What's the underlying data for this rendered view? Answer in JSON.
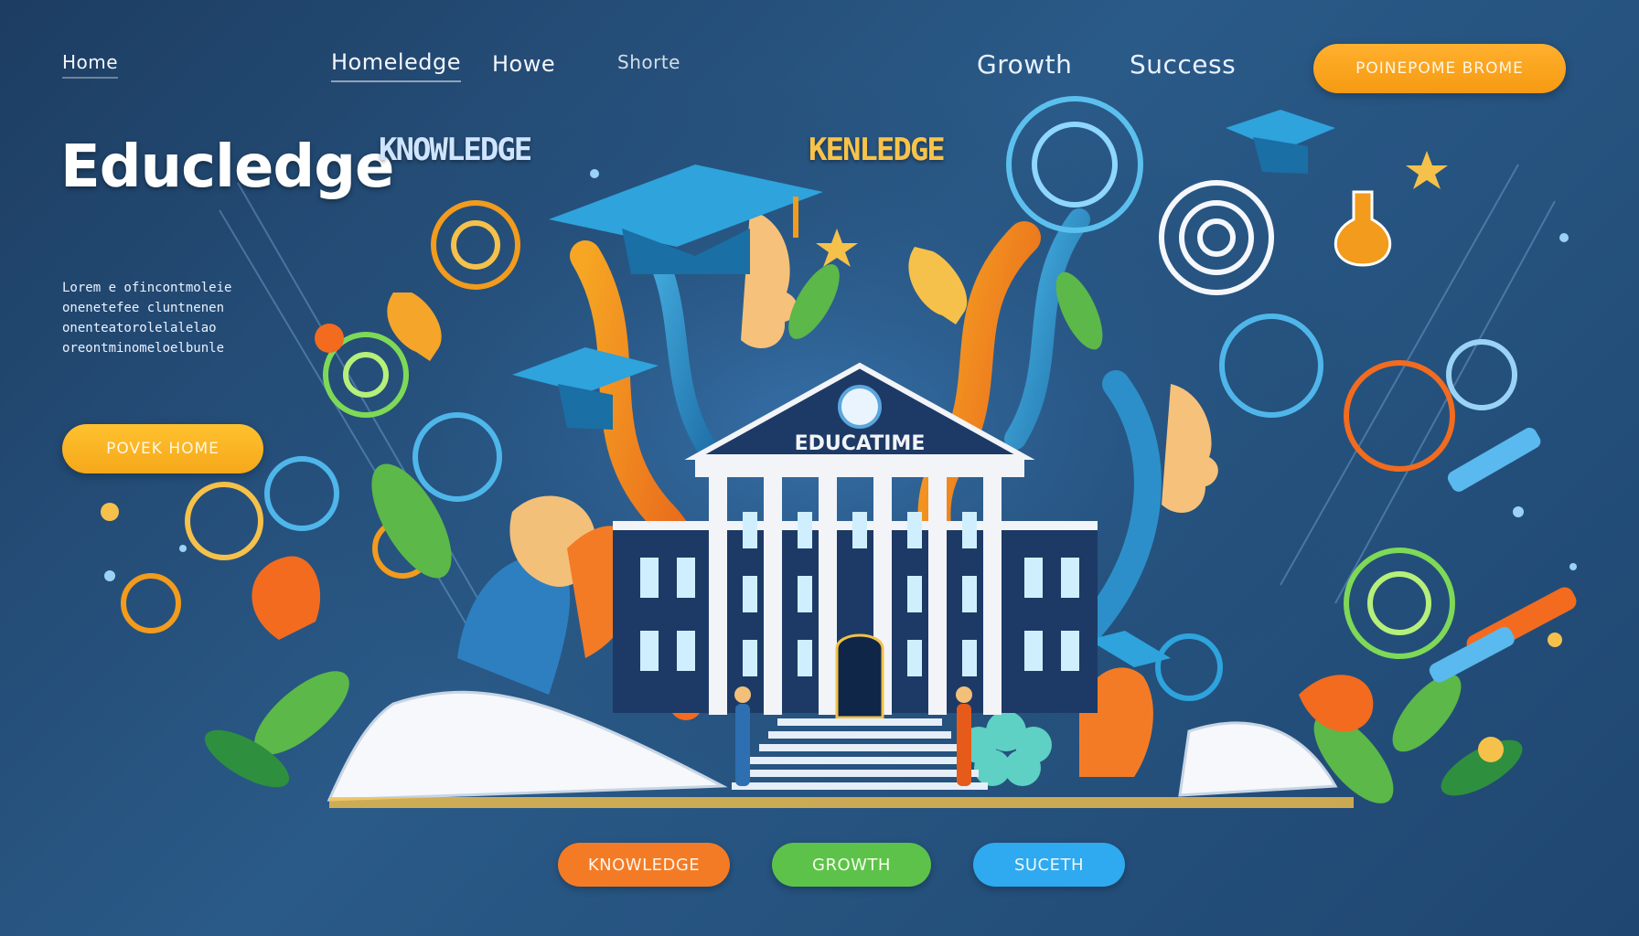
{
  "nav": {
    "items": [
      {
        "label": "Home"
      },
      {
        "label": "Homeledge"
      },
      {
        "label": "Howe"
      },
      {
        "label": "Shorte"
      },
      {
        "label": "Growth"
      },
      {
        "label": "Success"
      }
    ],
    "cta_label": "POINEPOME BROME"
  },
  "hero": {
    "brand": "Educledge",
    "brand_tag": "KNOWLEDGE",
    "art_text": "KENLEDGE",
    "lorem_lines": [
      "Lorem e ofincontmoleie",
      "onenetefee cluntnenen",
      "onenteatorolelalelao",
      "oreontminomeloelbunle"
    ],
    "cta_label": "POVEK HOME"
  },
  "building": {
    "label": "EDUCATIME"
  },
  "pills": {
    "knowledge": "KNOWLEDGE",
    "growth": "GROWTH",
    "success": "SUCETH"
  },
  "colors": {
    "background": "#244e7a",
    "accent_orange": "#f69a12",
    "accent_green": "#5dc24a",
    "accent_blue": "#2fa9ef"
  }
}
